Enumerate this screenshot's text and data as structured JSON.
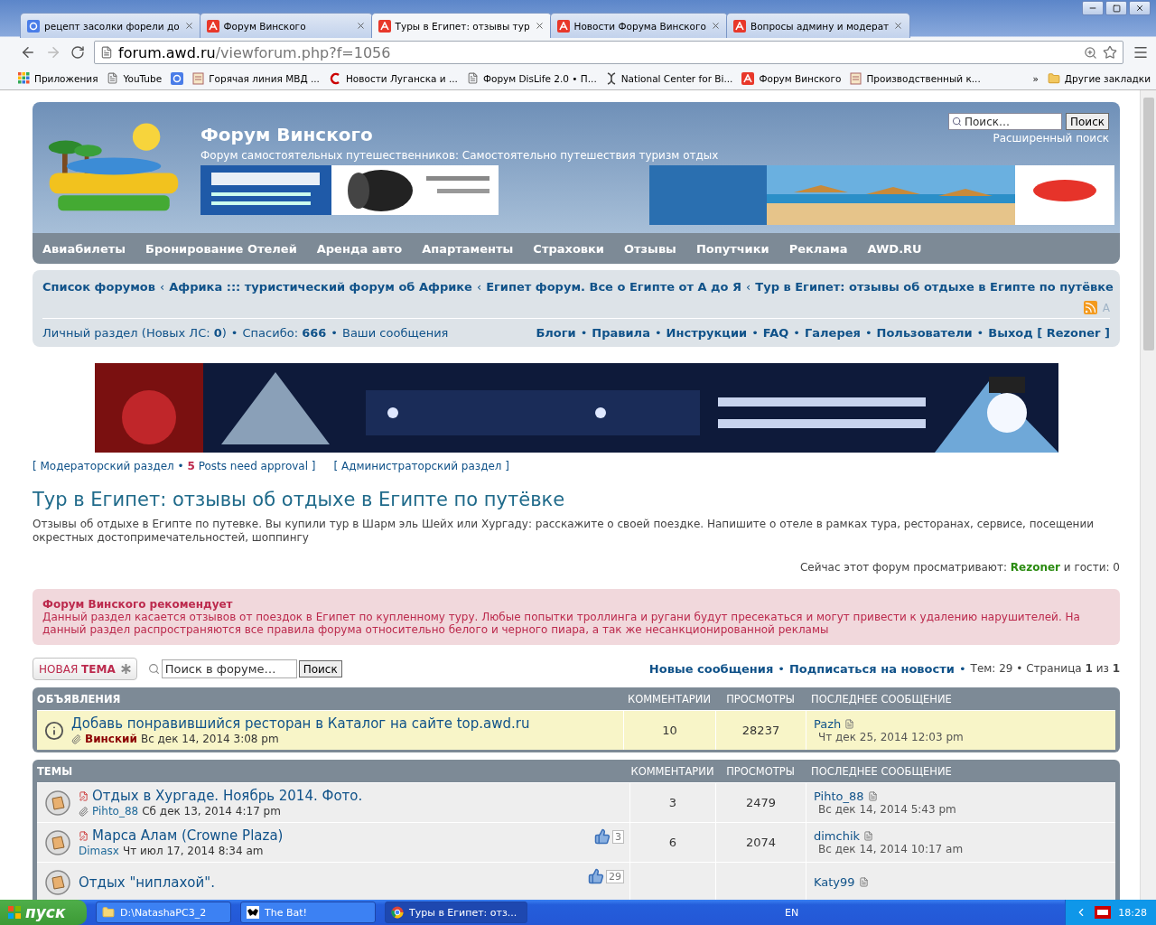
{
  "browser": {
    "tabs": [
      {
        "title": "рецепт засолки форели до",
        "selected": false
      },
      {
        "title": "Форум Винского",
        "selected": false
      },
      {
        "title": "Туры в Египет: отзывы тур",
        "selected": true
      },
      {
        "title": "Новости Форума Винского",
        "selected": false
      },
      {
        "title": "Вопросы админу и модерат",
        "selected": false
      }
    ],
    "url": {
      "host": "forum.awd.ru",
      "path": "/viewforum.php?f=1056"
    },
    "bookmarks": [
      {
        "kind": "labeled",
        "label": "Приложения"
      },
      {
        "kind": "labeled",
        "label": "YouTube"
      },
      {
        "kind": "icon"
      },
      {
        "kind": "labeled",
        "label": "Горячая линия МВД ..."
      },
      {
        "kind": "labeled",
        "label": "Новости Луганска и ..."
      },
      {
        "kind": "labeled",
        "label": "Форум DisLife 2.0 • П..."
      },
      {
        "kind": "labeled",
        "label": "National Center for Bi..."
      },
      {
        "kind": "labeled",
        "label": "Форум Винского"
      },
      {
        "kind": "labeled",
        "label": "Производственный к..."
      }
    ],
    "more": "»",
    "other_bookmarks": "Другие закладки"
  },
  "header": {
    "title": "Форум Винского",
    "subtitle": "Форум самостоятельных путешественников: Самостоятельно путешествия туризм отдых",
    "search": {
      "placeholder": "Поиск…",
      "button": "Поиск"
    },
    "advanced_search": "Расширенный поиск"
  },
  "nav": [
    "Авиабилеты",
    "Бронирование Отелей",
    "Аренда авто",
    "Апартаменты",
    "Страховки",
    "Отзывы",
    "Попутчики",
    "Реклама",
    "AWD.RU"
  ],
  "breadcrumbs": {
    "separator": "‹",
    "items": [
      "Список форумов",
      "Африка ::: туристический форум об Африке",
      "Египет форум. Все о Египте от А до Я",
      "Тур в Египет: отзывы об отдыхе в Египте по путёвке"
    ]
  },
  "font_toggle": "A",
  "user_bar": {
    "separator": "•",
    "left": [
      "Личный раздел (Новых ЛС: **0**)",
      "Спасибо: **666**",
      "Ваши сообщения"
    ],
    "right": [
      "Блоги",
      "Правила",
      "Инструкции",
      "FAQ",
      "Галерея",
      "Пользователи",
      "Выход [ Rezoner ]"
    ]
  },
  "mod_links": [
    "[ Модераторский раздел • **5** Posts need approval ]",
    "[ Администраторский раздел ]"
  ],
  "forum": {
    "title": "Тур в Египет: отзывы об отдыхе в Египте по путёвке",
    "description": "Отзывы об отдыхе в Египте по путевке. Вы купили тур в Шарм эль Шейх или Хургаду: расскажите о своей поездке. Напишите о отеле в рамках тура, ресторанах, сервисе, посещении окрестных достопримечательностей, шоппингу",
    "viewers": "Сейчас этот форум просматривают: **Rezoner** и гости: 0"
  },
  "notice": {
    "title": "Форум Винского рекомендует",
    "text": "Данный раздел касается отзывов от поездок в Египет по купленному туру. Любые попытки троллинга и ругани будут пресекаться и могут привести к удалению нарушителей. На данный раздел распространяются все правила форума относительно белого и черного пиара, а так же несанкционированной рекламы"
  },
  "actions": {
    "new_topic": "НОВАЯ **ТЕМА**",
    "search": {
      "placeholder": "Поиск в форуме…",
      "button": "Поиск"
    },
    "links": [
      "Новые сообщения",
      "Подписаться на новости"
    ],
    "stats": "Тем: 29 • Страница **1** из **1**",
    "separator": "•"
  },
  "sections": [
    {
      "title": "ОБЪЯВЛЕНИЯ",
      "columns": [
        "КОММЕНТАРИИ",
        "ПРОСМОТРЫ",
        "ПОСЛЕДНЕЕ СООБЩЕНИЕ"
      ],
      "rows": [
        {
          "kind": "announcement",
          "title": "Добавь понравившийся ресторан в Каталог на сайте top.awd.ru",
          "attachment": true,
          "marked": false,
          "author": {
            "name": "Винский",
            "color": "#8b0000"
          },
          "date": "Вс дек 14, 2014 3:08 pm",
          "replies": "10",
          "views": "28237",
          "last_author": "Pazh",
          "last_date": "Чт дек 25, 2014 12:03 pm"
        }
      ]
    },
    {
      "title": "ТЕМЫ",
      "columns": [
        "КОММЕНТАРИИ",
        "ПРОСМОТРЫ",
        "ПОСЛЕДНЕЕ СООБЩЕНИЕ"
      ],
      "rows": [
        {
          "kind": "topic",
          "title": "Отдых в Хургаде. Ноябрь 2014. Фото.",
          "attachment": true,
          "marked": true,
          "author": {
            "name": "Pihto_88",
            "color": "#1f6a9a"
          },
          "date": "Сб дек 13, 2014 4:17 pm",
          "replies": "3",
          "views": "2479",
          "last_author": "Pihto_88",
          "last_date": "Вс дек 14, 2014 5:43 pm"
        },
        {
          "kind": "topic",
          "title": "Марса Алам (Crowne Plaza)",
          "attachment": false,
          "marked": true,
          "likes": "3",
          "author": {
            "name": "Dimasx",
            "color": "#1f6a9a"
          },
          "date": "Чт июл 17, 2014 8:34 am",
          "replies": "6",
          "views": "2074",
          "last_author": "dimchik",
          "last_date": "Вс дек 14, 2014 10:17 am"
        },
        {
          "kind": "topic",
          "title": "Отдых \"ниплахой\".",
          "attachment": false,
          "marked": false,
          "likes": "29",
          "last_author": "Katy99"
        }
      ]
    }
  ],
  "taskbar": {
    "start": "пуск",
    "tasks": [
      {
        "label": "D:\\NatashaPC3_2",
        "selected": false
      },
      {
        "label": "The Bat!",
        "selected": false
      },
      {
        "label": "Туры в Египет: отз...",
        "selected": true
      }
    ],
    "lang": "EN",
    "time": "18:28"
  }
}
